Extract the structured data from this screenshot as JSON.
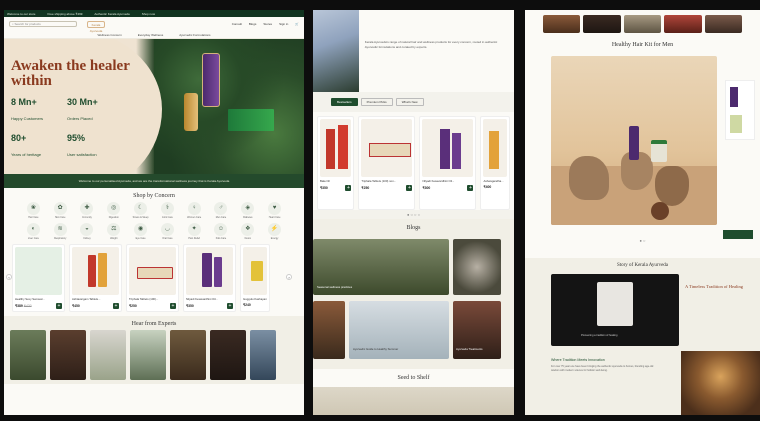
{
  "ticker": [
    "Welcome to our store",
    "Free shipping above ₹499",
    "Authentic Kerala Ayurveda",
    "Shop now"
  ],
  "header": {
    "search_placeholder": "Search for products",
    "logo": "Kerala Ayurveda",
    "nav": [
      "Consult",
      "Blogs",
      "Stores",
      "Sign in"
    ]
  },
  "category_nav": [
    "Wellness Concern",
    "Everyday Wellness",
    "Ayurvedic Formulations"
  ],
  "hero": {
    "headline": "Awaken the healer within",
    "stats": [
      {
        "value": "8 Mn+",
        "label": "Happy Customers"
      },
      {
        "value": "30 Mn+",
        "label": "Orders Placed"
      },
      {
        "value": "80+",
        "label": "Years of heritage"
      },
      {
        "value": "95%",
        "label": "User satisfaction"
      }
    ],
    "band_text": "Welcome to our personalised Ayurveda, and we are the transformational wellness journey that is Kerala Ayurveda"
  },
  "shop_by_concern": {
    "title": "Shop by Concern",
    "items": [
      {
        "icon": "hair-icon",
        "label": "Hair Care"
      },
      {
        "icon": "skin-icon",
        "label": "Skin Care"
      },
      {
        "icon": "immunity-icon",
        "label": "Immunity"
      },
      {
        "icon": "digestion-icon",
        "label": "Digestion"
      },
      {
        "icon": "stress-icon",
        "label": "Stress & Sleep"
      },
      {
        "icon": "joint-icon",
        "label": "Joint Care"
      },
      {
        "icon": "women-icon",
        "label": "Women Care"
      },
      {
        "icon": "men-icon",
        "label": "Men Care"
      },
      {
        "icon": "diabetes-icon",
        "label": "Diabetes"
      },
      {
        "icon": "heart-icon",
        "label": "Heart Care"
      },
      {
        "icon": "liver-icon",
        "label": "Liver Care"
      },
      {
        "icon": "respiratory-icon",
        "label": "Respiratory"
      },
      {
        "icon": "kidney-icon",
        "label": "Kidney"
      },
      {
        "icon": "weight-icon",
        "label": "Weight"
      },
      {
        "icon": "eye-icon",
        "label": "Eye Care"
      },
      {
        "icon": "oral-icon",
        "label": "Oral Care"
      },
      {
        "icon": "pain-icon",
        "label": "Pain Relief"
      },
      {
        "icon": "kids-icon",
        "label": "Kids Care"
      },
      {
        "icon": "detox-icon",
        "label": "Detox"
      },
      {
        "icon": "energy-icon",
        "label": "Energy"
      }
    ]
  },
  "products_row_1": [
    {
      "name": "Healthy Sexy Sensual...",
      "price": "₹389",
      "mrp": "₹430"
    },
    {
      "name": "Ashtavargam Tablets...",
      "price": "₹450",
      "mrp": ""
    },
    {
      "name": "Triphala Tablets (100)...",
      "price": "₹250",
      "mrp": ""
    },
    {
      "name": "Nilyadi Kesavardhini Oil...",
      "price": "₹350",
      "mrp": ""
    },
    {
      "name": "Guggulu Kashayam...",
      "price": "₹240",
      "mrp": ""
    }
  ],
  "experts": {
    "title": "Hear from Experts"
  },
  "col2": {
    "intro_text": "Kerala Ayurveda's range of natural hair and wellness products for every concern, rooted in authentic Ayurvedic formulations and curated by experts.",
    "tabs": [
      "Bestsellers",
      "Premium Picks",
      "What's New"
    ],
    "products": [
      {
        "name": "Bala Oil",
        "price": "₹350"
      },
      {
        "name": "Triphala Tablets (100) non...",
        "price": "₹250"
      },
      {
        "name": "Nilyadi Kesavardhini Oil...",
        "price": "₹300"
      },
      {
        "name": "Ashwagandha...",
        "price": "₹400"
      }
    ],
    "blogs_title": "Blogs",
    "blog_cards": [
      "Seasonal wellness practices",
      "Ayurvedic Guide to Healthy Summer",
      "Ayurveda Treatments"
    ],
    "seed_title": "Seed to Shelf"
  },
  "col3": {
    "kit_title": "Healthy Hair Kit for Men",
    "story_title": "Story of Kerala Ayurveda",
    "story_side": "A Timeless Tradition of Healing",
    "story_video_caption": "Pioneering a tradition of healing",
    "story2_heading": "Where Tradition Meets Innovation",
    "story2_text": "For over 75 years we have been bringing the authentic ayurveda to homes, blending age-old wisdom with modern science for holistic well-being."
  }
}
